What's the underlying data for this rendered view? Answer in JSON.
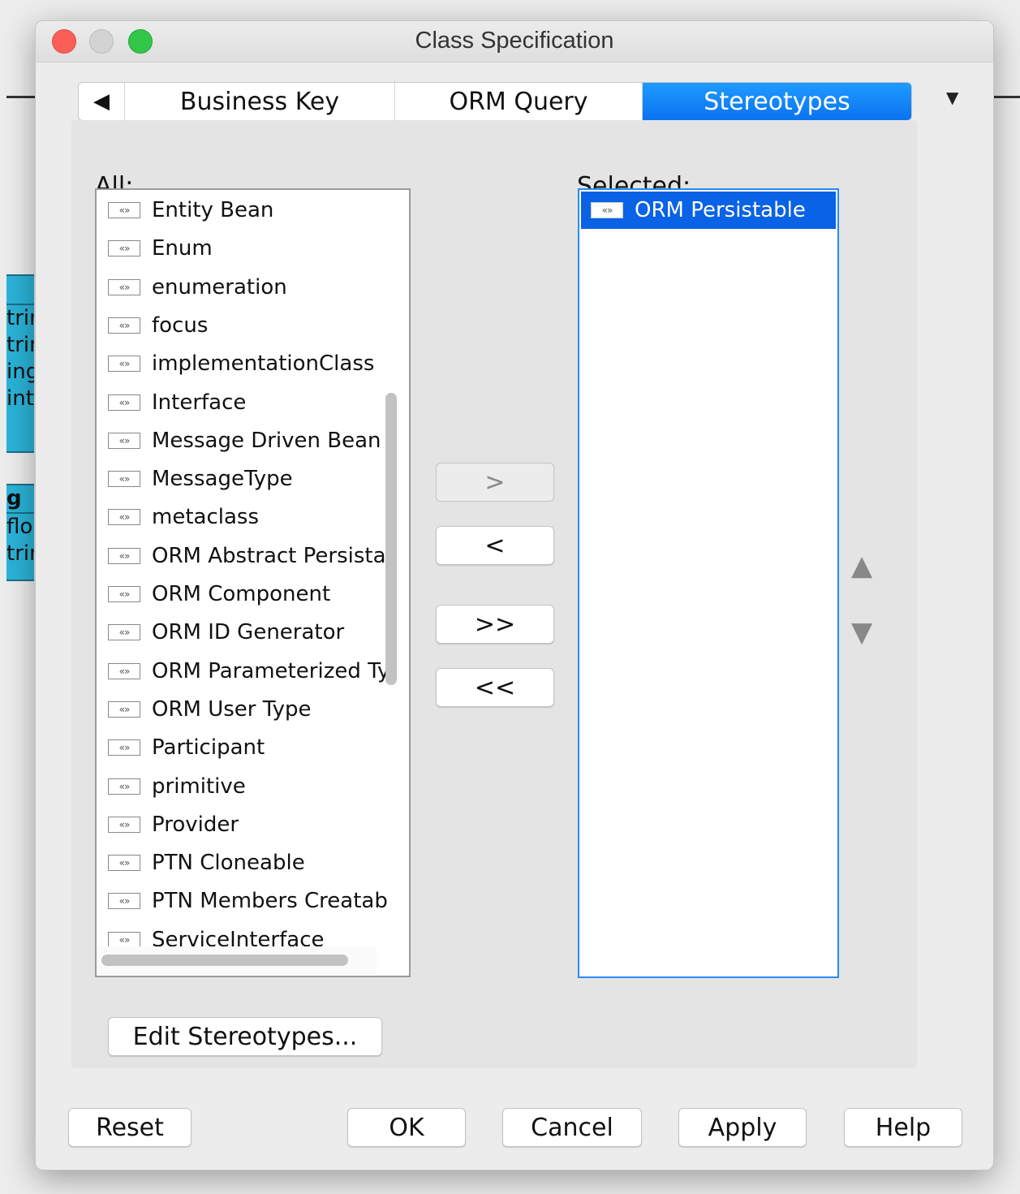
{
  "dialog": {
    "title": "Class Specification"
  },
  "tabs": [
    {
      "label": "Business Key"
    },
    {
      "label": "ORM Query"
    },
    {
      "label": "Stereotypes",
      "selected": true
    }
  ],
  "tab_nav": {
    "back_glyph": "◀",
    "overflow_glyph": "▼"
  },
  "all_list": {
    "label": "All:",
    "items": [
      "Entity Bean",
      "Enum",
      "enumeration",
      "focus",
      "implementationClass",
      "Interface",
      "Message Driven Bean",
      "MessageType",
      "metaclass",
      "ORM Abstract Persista",
      "ORM Component",
      "ORM ID Generator",
      "ORM Parameterized Ty",
      "ORM User Type",
      "Participant",
      "primitive",
      "Provider",
      "PTN Cloneable",
      "PTN Members Creatab",
      "ServiceInterface"
    ]
  },
  "selected_list": {
    "label": "Selected:",
    "items": [
      "ORM Persistable"
    ]
  },
  "transfer_buttons": {
    "add": ">",
    "remove": "<",
    "add_all": ">>",
    "remove_all": "<<"
  },
  "icons": {
    "stereotype": "«»",
    "up": "▲",
    "down": "▼"
  },
  "edit_button": "Edit Stereotypes...",
  "footer": {
    "reset": "Reset",
    "ok": "OK",
    "cancel": "Cancel",
    "apply": "Apply",
    "help": "Help"
  },
  "background_fragments": [
    "trin",
    "trin",
    "ing",
    "int",
    "g",
    "flo",
    "trin"
  ],
  "colors": {
    "accent": "#0a62e6",
    "tab_selected": "#1e9bff",
    "close": "#fc5f57",
    "zoom": "#32c748"
  }
}
